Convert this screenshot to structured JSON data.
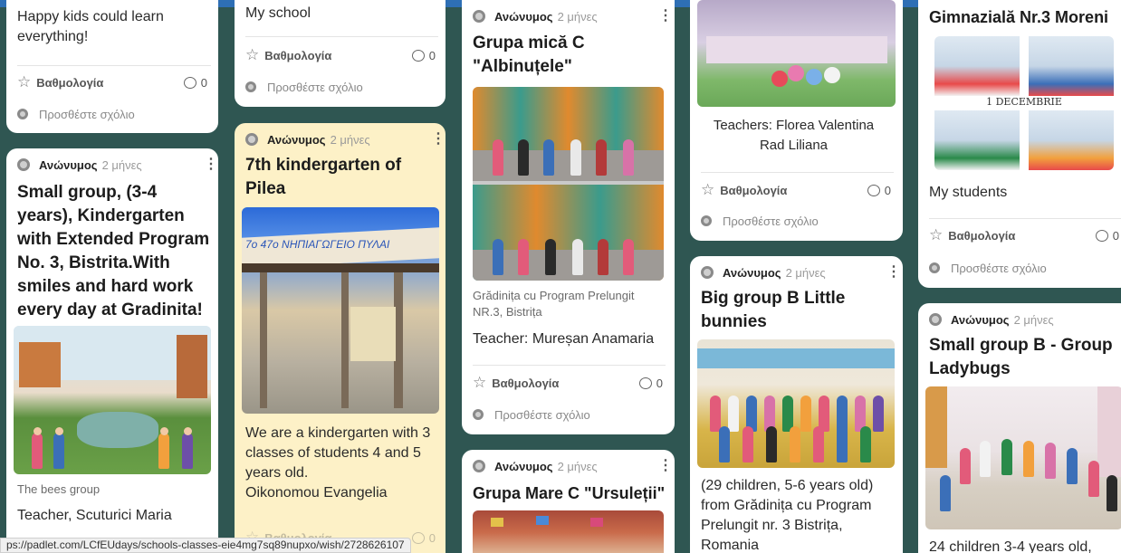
{
  "common": {
    "rating_label": "Βαθμολογία",
    "comment_count": "0",
    "add_comment": "Προσθέστε σχόλιο",
    "author": "Ανώνυμος",
    "time": "2 μήνες"
  },
  "col1": {
    "top_text": "Happy kids could learn everything!",
    "card2_title": "Small group, (3-4 years), Kindergarten with Extended Program No. 3, Bistrita.With smiles and hard work every day at Gradinita!",
    "card2_caption": "The bees group",
    "card2_text": "Teacher, Scuturici Maria"
  },
  "col2": {
    "top_text": "My school",
    "card2_title": "7th kindergarten of Pilea",
    "card2_banner": "7ο 47ο ΝΗΠΙΑΓΩΓΕΙΟ ΠΥΛΑΙ",
    "card2_text": "We are a kindergarten with 3 classes of students 4 and 5 years old.",
    "card2_text2": "Oikonomou Evangelia",
    "partial_label": "Βαθμολογία"
  },
  "col3": {
    "card1_title": "Grupa mică C \"Albinuțele\"",
    "card1_caption": "Grădinița cu Program Prelungit NR.3,  Bistrița",
    "card1_text": "Teacher: Mureșan Anamaria",
    "card2_title": "Grupa Mare C \"Ursuleții\""
  },
  "col4": {
    "card1_text": "Teachers: Florea Valentina Rad Liliana",
    "card2_title": "Big group B Little bunnies",
    "card2_text": "(29 children, 5-6 years old) from Grădinița cu Program Prelungit nr. 3 Bistrița, Romania"
  },
  "col5": {
    "card1_title": "Gimnazială Nr.3 Moreni",
    "collage_label": "1 DECEMBRIE",
    "card1_text": "My students",
    "card2_title": "Small group B - Group Ladybugs",
    "card2_text": "24 children 3-4 years old,"
  },
  "status_url": "ps://padlet.com/LCfEUdays/schools-classes-eie4mg7sq89nupxo/wish/2728626107",
  "colors": {
    "background": "#2f5652",
    "yellow_card": "#fdf1c7",
    "accent_bar": "#2e6fb5"
  }
}
